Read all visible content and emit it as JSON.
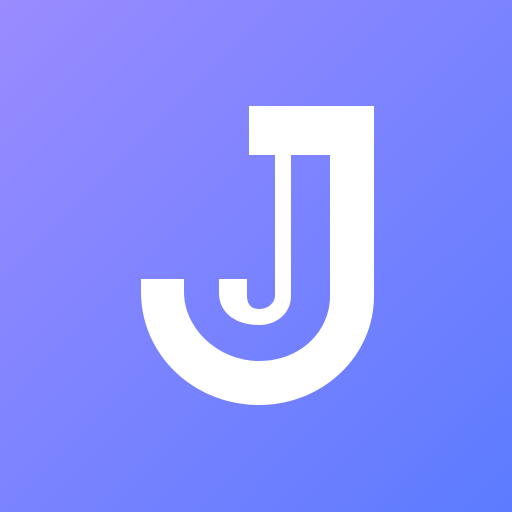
{
  "icon": {
    "name": "j-logo-icon",
    "glyph": "J",
    "colors": {
      "gradient_start": "#9A8BFF",
      "gradient_end": "#5C7BFF",
      "glyph": "#FFFFFF"
    }
  }
}
